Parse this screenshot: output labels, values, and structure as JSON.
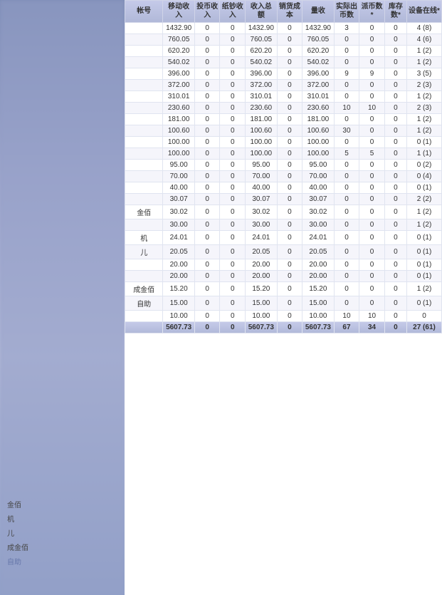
{
  "header": {
    "cols": [
      {
        "key": "account",
        "label": "帐号"
      },
      {
        "key": "mobile_income",
        "label": "移动收入"
      },
      {
        "key": "coin_income",
        "label": "投币收入"
      },
      {
        "key": "paper_income",
        "label": "纸钞收入"
      },
      {
        "key": "total_amount",
        "label": "收入总额"
      },
      {
        "key": "sales_cost",
        "label": "销货成本"
      },
      {
        "key": "sales",
        "label": "量收"
      },
      {
        "key": "actual_coins",
        "label": "实际出币数"
      },
      {
        "key": "issued_coins",
        "label": "派币数*"
      },
      {
        "key": "stock",
        "label": "库存数*"
      },
      {
        "key": "device_online",
        "label": "设备在线*"
      }
    ]
  },
  "rows": [
    {
      "mobile_income": "1432.90",
      "coin_income": "0",
      "paper_income": "0",
      "total_amount": "1432.90",
      "sales_cost": "0",
      "sales": "1432.90",
      "actual_coins": "3",
      "issued_coins": "0",
      "stock": "0",
      "device_online": "4 (8)"
    },
    {
      "mobile_income": "760.05",
      "coin_income": "0",
      "paper_income": "0",
      "total_amount": "760.05",
      "sales_cost": "0",
      "sales": "760.05",
      "actual_coins": "0",
      "issued_coins": "0",
      "stock": "0",
      "device_online": "4 (6)"
    },
    {
      "mobile_income": "620.20",
      "coin_income": "0",
      "paper_income": "0",
      "total_amount": "620.20",
      "sales_cost": "0",
      "sales": "620.20",
      "actual_coins": "0",
      "issued_coins": "0",
      "stock": "0",
      "device_online": "1 (2)"
    },
    {
      "mobile_income": "540.02",
      "coin_income": "0",
      "paper_income": "0",
      "total_amount": "540.02",
      "sales_cost": "0",
      "sales": "540.02",
      "actual_coins": "0",
      "issued_coins": "0",
      "stock": "0",
      "device_online": "1 (2)"
    },
    {
      "mobile_income": "396.00",
      "coin_income": "0",
      "paper_income": "0",
      "total_amount": "396.00",
      "sales_cost": "0",
      "sales": "396.00",
      "actual_coins": "9",
      "issued_coins": "9",
      "stock": "0",
      "device_online": "3 (5)"
    },
    {
      "mobile_income": "372.00",
      "coin_income": "0",
      "paper_income": "0",
      "total_amount": "372.00",
      "sales_cost": "0",
      "sales": "372.00",
      "actual_coins": "0",
      "issued_coins": "0",
      "stock": "0",
      "device_online": "2 (3)"
    },
    {
      "mobile_income": "310.01",
      "coin_income": "0",
      "paper_income": "0",
      "total_amount": "310.01",
      "sales_cost": "0",
      "sales": "310.01",
      "actual_coins": "0",
      "issued_coins": "0",
      "stock": "0",
      "device_online": "1 (2)"
    },
    {
      "mobile_income": "230.60",
      "coin_income": "0",
      "paper_income": "0",
      "total_amount": "230.60",
      "sales_cost": "0",
      "sales": "230.60",
      "actual_coins": "10",
      "issued_coins": "10",
      "stock": "0",
      "device_online": "2 (3)"
    },
    {
      "mobile_income": "181.00",
      "coin_income": "0",
      "paper_income": "0",
      "total_amount": "181.00",
      "sales_cost": "0",
      "sales": "181.00",
      "actual_coins": "0",
      "issued_coins": "0",
      "stock": "0",
      "device_online": "1 (2)"
    },
    {
      "mobile_income": "100.60",
      "coin_income": "0",
      "paper_income": "0",
      "total_amount": "100.60",
      "sales_cost": "0",
      "sales": "100.60",
      "actual_coins": "30",
      "issued_coins": "0",
      "stock": "0",
      "device_online": "1 (2)"
    },
    {
      "mobile_income": "100.00",
      "coin_income": "0",
      "paper_income": "0",
      "total_amount": "100.00",
      "sales_cost": "0",
      "sales": "100.00",
      "actual_coins": "0",
      "issued_coins": "0",
      "stock": "0",
      "device_online": "0 (1)"
    },
    {
      "mobile_income": "100.00",
      "coin_income": "0",
      "paper_income": "0",
      "total_amount": "100.00",
      "sales_cost": "0",
      "sales": "100.00",
      "actual_coins": "5",
      "issued_coins": "5",
      "stock": "0",
      "device_online": "1 (1)"
    },
    {
      "mobile_income": "95.00",
      "coin_income": "0",
      "paper_income": "0",
      "total_amount": "95.00",
      "sales_cost": "0",
      "sales": "95.00",
      "actual_coins": "0",
      "issued_coins": "0",
      "stock": "0",
      "device_online": "0 (2)"
    },
    {
      "mobile_income": "70.00",
      "coin_income": "0",
      "paper_income": "0",
      "total_amount": "70.00",
      "sales_cost": "0",
      "sales": "70.00",
      "actual_coins": "0",
      "issued_coins": "0",
      "stock": "0",
      "device_online": "0 (4)"
    },
    {
      "mobile_income": "40.00",
      "coin_income": "0",
      "paper_income": "0",
      "total_amount": "40.00",
      "sales_cost": "0",
      "sales": "40.00",
      "actual_coins": "0",
      "issued_coins": "0",
      "stock": "0",
      "device_online": "0 (1)"
    },
    {
      "mobile_income": "30.07",
      "coin_income": "0",
      "paper_income": "0",
      "total_amount": "30.07",
      "sales_cost": "0",
      "sales": "30.07",
      "actual_coins": "0",
      "issued_coins": "0",
      "stock": "0",
      "device_online": "2 (2)"
    },
    {
      "account_label": "金佰",
      "mobile_income": "30.02",
      "coin_income": "0",
      "paper_income": "0",
      "total_amount": "30.02",
      "sales_cost": "0",
      "sales": "30.02",
      "actual_coins": "0",
      "issued_coins": "0",
      "stock": "0",
      "device_online": "1 (2)"
    },
    {
      "mobile_income": "30.00",
      "coin_income": "0",
      "paper_income": "0",
      "total_amount": "30.00",
      "sales_cost": "0",
      "sales": "30.00",
      "actual_coins": "0",
      "issued_coins": "0",
      "stock": "0",
      "device_online": "1 (2)"
    },
    {
      "account_label": "机",
      "mobile_income": "24.01",
      "coin_income": "0",
      "paper_income": "0",
      "total_amount": "24.01",
      "sales_cost": "0",
      "sales": "24.01",
      "actual_coins": "0",
      "issued_coins": "0",
      "stock": "0",
      "device_online": "0 (1)"
    },
    {
      "account_label": "儿",
      "mobile_income": "20.05",
      "coin_income": "0",
      "paper_income": "0",
      "total_amount": "20.05",
      "sales_cost": "0",
      "sales": "20.05",
      "actual_coins": "0",
      "issued_coins": "0",
      "stock": "0",
      "device_online": "0 (1)"
    },
    {
      "mobile_income": "20.00",
      "coin_income": "0",
      "paper_income": "0",
      "total_amount": "20.00",
      "sales_cost": "0",
      "sales": "20.00",
      "actual_coins": "0",
      "issued_coins": "0",
      "stock": "0",
      "device_online": "0 (1)"
    },
    {
      "mobile_income": "20.00",
      "coin_income": "0",
      "paper_income": "0",
      "total_amount": "20.00",
      "sales_cost": "0",
      "sales": "20.00",
      "actual_coins": "0",
      "issued_coins": "0",
      "stock": "0",
      "device_online": "0 (1)"
    },
    {
      "account_label": "成金佰",
      "mobile_income": "15.20",
      "coin_income": "0",
      "paper_income": "0",
      "total_amount": "15.20",
      "sales_cost": "0",
      "sales": "15.20",
      "actual_coins": "0",
      "issued_coins": "0",
      "stock": "0",
      "device_online": "1 (2)"
    },
    {
      "account_label": "自助",
      "mobile_income": "15.00",
      "coin_income": "0",
      "paper_income": "0",
      "total_amount": "15.00",
      "sales_cost": "0",
      "sales": "15.00",
      "actual_coins": "0",
      "issued_coins": "0",
      "stock": "0",
      "device_online": "0 (1)"
    },
    {
      "mobile_income": "10.00",
      "coin_income": "0",
      "paper_income": "0",
      "total_amount": "10.00",
      "sales_cost": "0",
      "sales": "10.00",
      "actual_coins": "10",
      "issued_coins": "10",
      "stock": "0",
      "device_online": "0"
    }
  ],
  "totals": {
    "mobile_income": "5607.73",
    "coin_income": "0",
    "paper_income": "0",
    "total_amount": "5607.73",
    "sales_cost": "0",
    "sales": "5607.73",
    "actual_coins": "67",
    "issued_coins": "34",
    "stock": "0",
    "device_online": "27 (61)"
  },
  "sidebar": {
    "labels": [
      "金佰",
      "机",
      "儿",
      "成金佰",
      "自助"
    ]
  }
}
